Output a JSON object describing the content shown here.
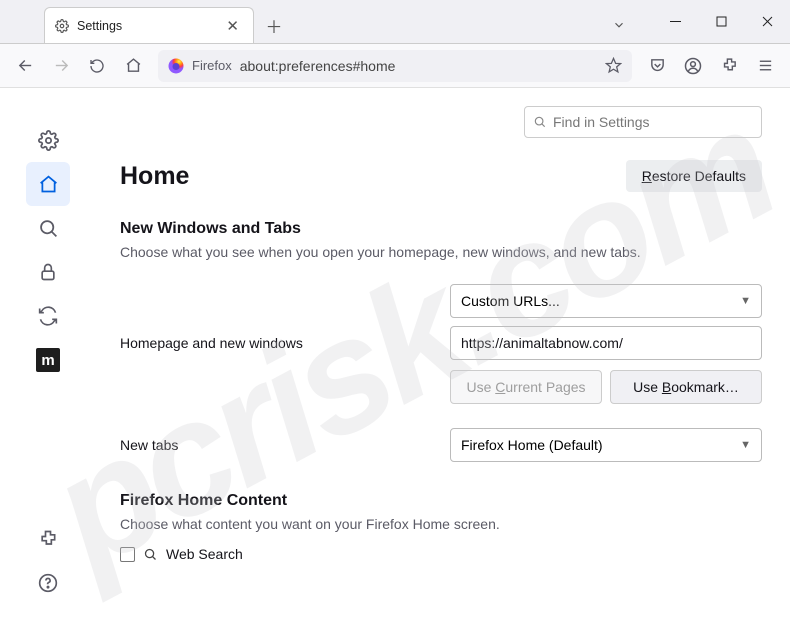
{
  "tab": {
    "title": "Settings"
  },
  "urlbar": {
    "identity_label": "Firefox",
    "url": "about:preferences#home"
  },
  "find": {
    "placeholder": "Find in Settings"
  },
  "page": {
    "title": "Home",
    "restore_label": "Restore Defaults",
    "section1_title": "New Windows and Tabs",
    "section1_desc": "Choose what you see when you open your homepage, new windows, and new tabs.",
    "homepage_label": "Homepage and new windows",
    "homepage_select": "Custom URLs...",
    "homepage_value": "https://animaltabnow.com/",
    "use_current": "Use Current Pages",
    "use_bookmark": "Use Bookmark…",
    "newtabs_label": "New tabs",
    "newtabs_select": "Firefox Home (Default)",
    "section2_title": "Firefox Home Content",
    "section2_desc": "Choose what content you want on your Firefox Home screen.",
    "websearch_label": "Web Search"
  }
}
